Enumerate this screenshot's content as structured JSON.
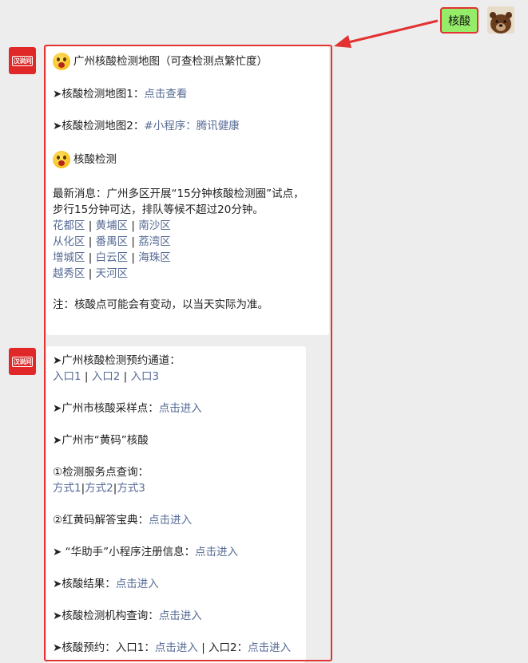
{
  "user": {
    "message": "核酸"
  },
  "bot": {
    "avatar_text": "汉说问"
  },
  "msg1": {
    "title": "广州核酸检测地图（可查检测点繁忙度）",
    "map1_label": "➤核酸检测地图1：",
    "map1_link": "点击查看",
    "map2_label": "➤核酸检测地图2：",
    "map2_link": "#小程序：腾讯健康",
    "section2_title": "核酸检测",
    "news_line1": "最新消息：广州多区开展“15分钟核酸检测圈”试点，",
    "news_line2": "步行15分钟可达，排队等候不超过20分钟。",
    "districts": [
      [
        "花都区",
        "黄埔区",
        "南沙区"
      ],
      [
        "从化区",
        "番禺区",
        "荔湾区"
      ],
      [
        "增城区",
        "白云区",
        "海珠区"
      ],
      [
        "越秀区",
        "天河区"
      ]
    ],
    "note": "注：核酸点可能会有变动，以当天实际为准。"
  },
  "msg2": {
    "booking_label": "➤广州核酸检测预约通道：",
    "entries": [
      "入口1",
      "入口2",
      "入口3"
    ],
    "sampling_label": "➤广州市核酸采样点：",
    "sampling_link": "点击进入",
    "yellow_code": "➤广州市“黄码”核酸",
    "service_label": "①检测服务点查询：",
    "methods": [
      "方式1",
      "方式2",
      "方式3"
    ],
    "faq_label": "②红黄码解答宝典：",
    "faq_link": "点击进入",
    "helper_label": "➤ “华助手”小程序注册信息：",
    "helper_link": "点击进入",
    "result_label": "➤核酸结果：",
    "result_link": "点击进入",
    "org_label": "➤核酸检测机构查询：",
    "org_link": "点击进入",
    "reserve_label": "➤核酸预约：入口1：",
    "reserve_link1": "点击进入",
    "reserve_mid": " | 入口2：",
    "reserve_link2": "点击进入"
  },
  "colors": {
    "link": "#576b95",
    "highlight": "#e23232",
    "user_bubble": "#95ec69"
  },
  "icons": [
    "bear-avatar-icon",
    "red-arrow-icon",
    "emoji-surprised-icon"
  ]
}
